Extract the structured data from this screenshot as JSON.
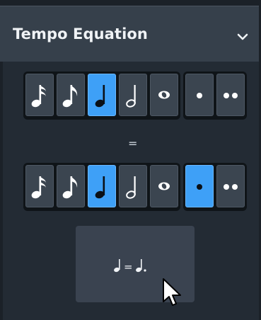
{
  "panel": {
    "title": "Tempo Equation",
    "toggle_icon": "chevron-down-icon"
  },
  "left_row": {
    "notes": [
      "sixteenth-note-icon",
      "eighth-note-icon",
      "quarter-note-icon",
      "half-note-icon",
      "whole-note-icon"
    ],
    "selected_note": "quarter-note-icon",
    "dots": [
      "single-dot-icon",
      "double-dot-icon"
    ],
    "selected_dot": null
  },
  "equals": "=",
  "right_row": {
    "notes": [
      "sixteenth-note-icon",
      "eighth-note-icon",
      "quarter-note-icon",
      "half-note-icon",
      "whole-note-icon"
    ],
    "selected_note": "quarter-note-icon",
    "dots": [
      "single-dot-icon",
      "double-dot-icon"
    ],
    "selected_dot": "single-dot-icon"
  },
  "preview": {
    "equals_sign": "="
  },
  "colors": {
    "accent": "#3ea0f7",
    "button": "#3b4550",
    "header": "#36404b",
    "background": "#232b34"
  }
}
